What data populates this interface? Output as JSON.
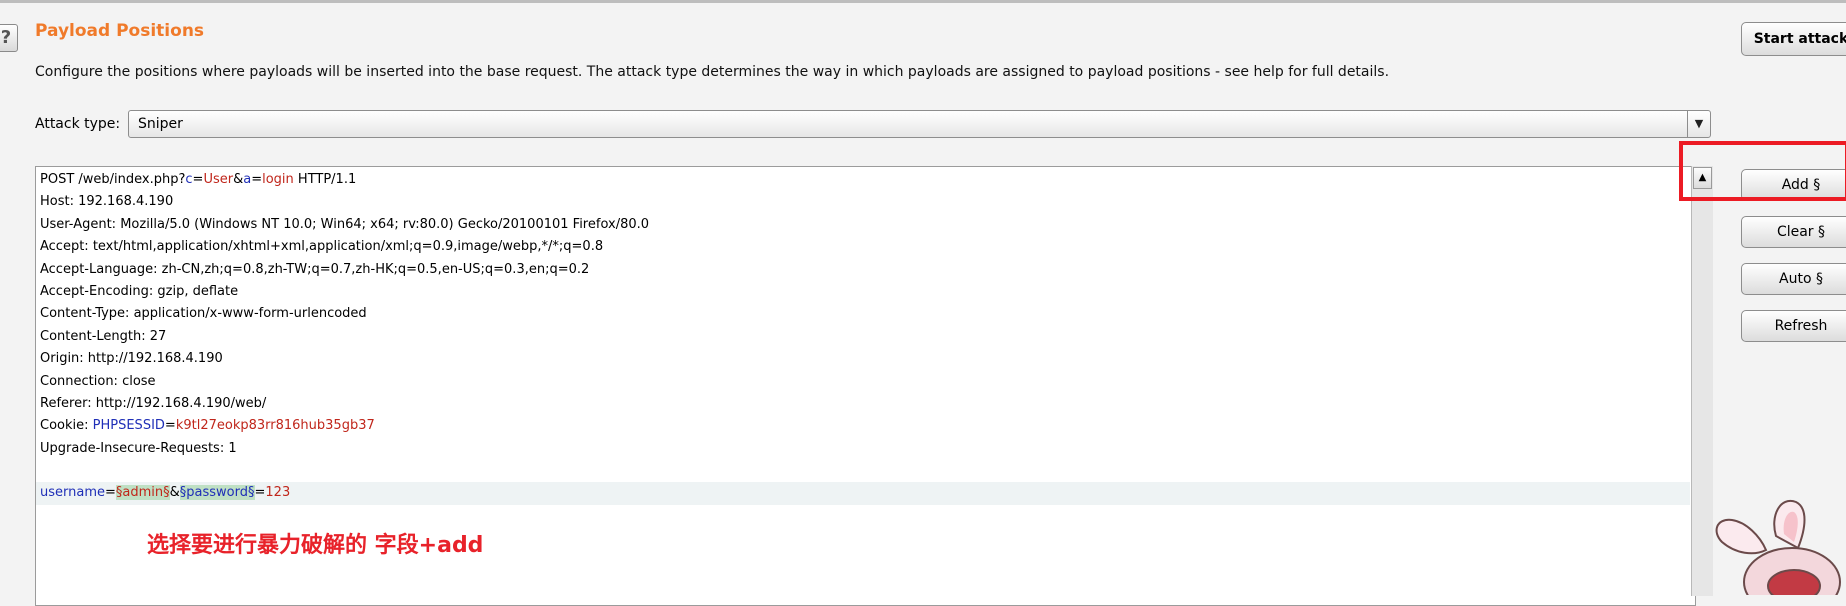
{
  "panel": {
    "help_icon": "?",
    "title": "Payload Positions",
    "description": "Configure the positions where payloads will be inserted into the base request. The attack type determines the way in which payloads are assigned to payload positions - see help for full details.",
    "attack_type_label": "Attack type:",
    "attack_type_value": "Sniper",
    "dropdown_arrow": "▼"
  },
  "request": {
    "l1": {
      "a": "POST /web/index.php?",
      "b": "c",
      "c": "=",
      "d": "User",
      "e": "&",
      "f": "a",
      "g": "=",
      "h": "login",
      "i": " HTTP/1.1"
    },
    "l2": "Host: 192.168.4.190",
    "l3": "User-Agent: Mozilla/5.0 (Windows NT 10.0; Win64; x64; rv:80.0) Gecko/20100101 Firefox/80.0",
    "l4": "Accept: text/html,application/xhtml+xml,application/xml;q=0.9,image/webp,*/*;q=0.8",
    "l5": "Accept-Language: zh-CN,zh;q=0.8,zh-TW;q=0.7,zh-HK;q=0.5,en-US;q=0.3,en;q=0.2",
    "l6": "Accept-Encoding: gzip, deflate",
    "l7": "Content-Type: application/x-www-form-urlencoded",
    "l8": "Content-Length: 27",
    "l9": "Origin: http://192.168.4.190",
    "l10": "Connection: close",
    "l11": "Referer: http://192.168.4.190/web/",
    "l12": {
      "a": "Cookie: ",
      "b": "PHPSESSID",
      "c": "=",
      "d": "k9tl27eokp83rr816hub35gb37"
    },
    "l13": "Upgrade-Insecure-Requests: 1",
    "body": {
      "k1": "username",
      "eq1": "=",
      "m1": "§admin§",
      "amp": "&",
      "m2": "§password§",
      "eq2": "=",
      "v2": "123"
    }
  },
  "annotation": "选择要进行暴力破解的 字段+add",
  "buttons": {
    "start_attack": "Start attack",
    "add": "Add §",
    "clear": "Clear §",
    "auto": "Auto §",
    "refresh": "Refresh"
  },
  "scrollbar_arrow": "▲",
  "colors": {
    "title": "#f07a2a",
    "param_name": "#1f2fb7",
    "param_value": "#c0261b",
    "payload_marker_bg": "#bfe0c4",
    "annotation": "#e8222a",
    "highlight_box": "#ec1b24"
  },
  "icons": [
    "help-icon",
    "dropdown-arrow-icon",
    "scroll-up-icon",
    "bunny-mascot-icon"
  ]
}
